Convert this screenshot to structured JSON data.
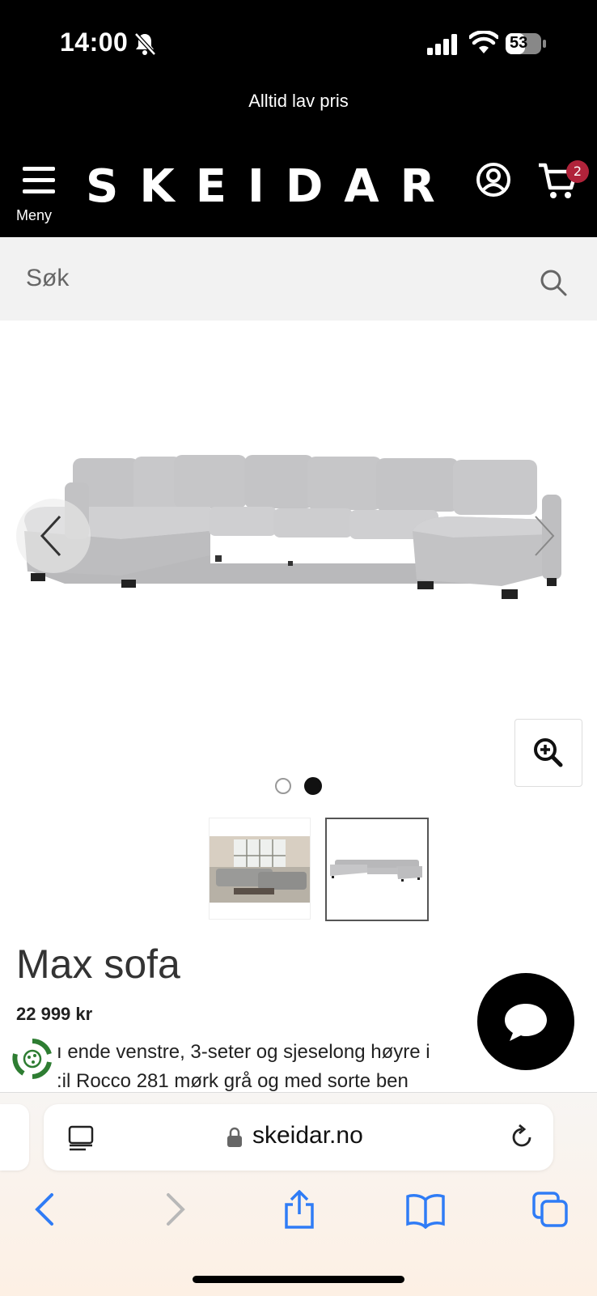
{
  "status_bar": {
    "time": "14:00",
    "battery": "53"
  },
  "promo": {
    "text": "Alltid lav pris"
  },
  "header": {
    "menu_label": "Meny",
    "logo": "SKEIDAR",
    "cart_count": "2"
  },
  "search": {
    "placeholder": "Søk"
  },
  "gallery": {
    "active_slide": 2,
    "total_slides": 2
  },
  "product": {
    "title": "Max sofa",
    "price": "22 999 kr",
    "description_line1": "ı ende venstre, 3-seter og sjeselong høyre i",
    "description_line2": ":il Rocco 281 mørk grå og med sorte ben"
  },
  "browser": {
    "url": "skeidar.no"
  },
  "colors": {
    "header_bg": "#000000",
    "badge": "#b0233a",
    "accent_ios": "#2f7cf6",
    "eco_green": "#2e7d32"
  }
}
